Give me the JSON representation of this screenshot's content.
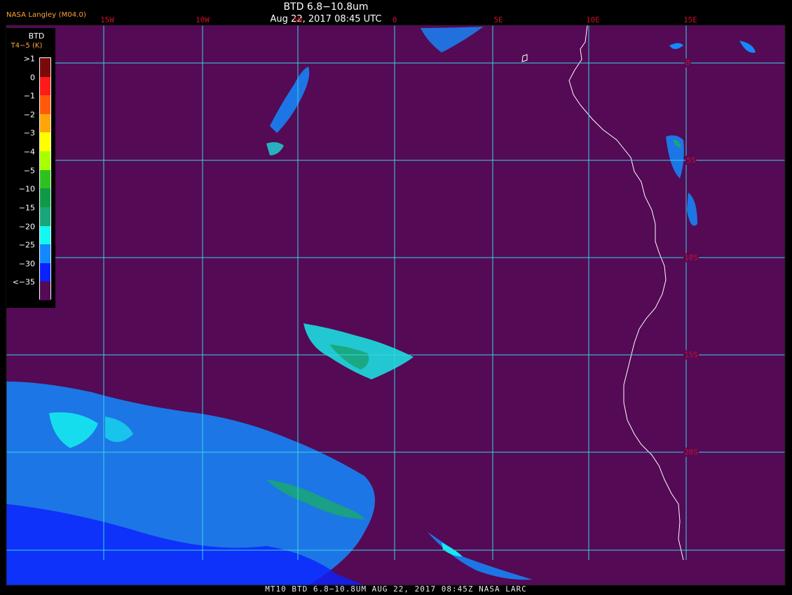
{
  "title": {
    "line1": "BTD 6.8−10.8um",
    "line2": "Aug 22, 2017 08:45 UTC"
  },
  "org_label": "NASA Langley (M04.0)",
  "legend": {
    "title1": "BTD",
    "title2": "T4−5 (K)",
    "stops": [
      {
        "label": ">1",
        "color": "#7a0a0a"
      },
      {
        "label": "0",
        "color": "#ff1a1a"
      },
      {
        "label": "−1",
        "color": "#ff5a0a"
      },
      {
        "label": "−2",
        "color": "#ffa50a"
      },
      {
        "label": "−3",
        "color": "#ffff00"
      },
      {
        "label": "−4",
        "color": "#a8ff00"
      },
      {
        "label": "−5",
        "color": "#2fc21f"
      },
      {
        "label": "−10",
        "color": "#0f9a48"
      },
      {
        "label": "−15",
        "color": "#1aa57a"
      },
      {
        "label": "−20",
        "color": "#15f7f0"
      },
      {
        "label": "−25",
        "color": "#1489ff"
      },
      {
        "label": "−30",
        "color": "#0b22ff"
      },
      {
        "label": "<−35",
        "color": "#540a55"
      }
    ]
  },
  "lon_labels": [
    "15W",
    "10W",
    "5W",
    "0",
    "5E",
    "10E",
    "15E"
  ],
  "lat_labels": [
    "0",
    "5S",
    "10S",
    "15S",
    "20S"
  ],
  "bottom_caption": "MT10  BTD 6.8−10.8UM   AUG 22, 2017 08:45Z   NASA LARC",
  "colors": {
    "background": "#540a55",
    "grid": "#34d6e6",
    "coast": "#ffffff",
    "label": "#c8102e"
  }
}
